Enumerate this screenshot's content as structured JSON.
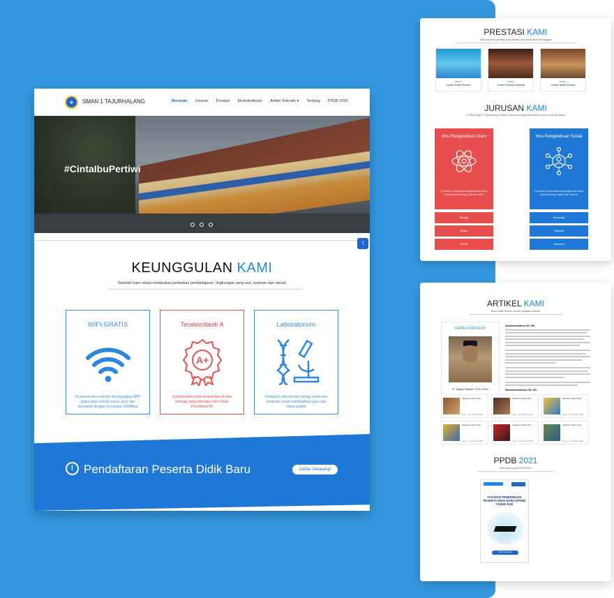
{
  "site": {
    "school_name": "SMAN 1 TAJURHALANG",
    "nav": [
      "Beranda",
      "Jurusan",
      "Prestasi",
      "Ekstrakulikuler",
      "Artikel Sekolah ▾",
      "Tentang",
      "PPDB 2020"
    ],
    "active_nav": "Beranda"
  },
  "hero": {
    "hashtag": "#CintaIbuPertiwi",
    "slides": 3
  },
  "keunggulan": {
    "title_a": "KEUNGGULAN ",
    "title_b": "KAMI",
    "subtitle": "Sekolah kami selalu melakukan perbaikan pembelajaran, lingkungan yang asri, nyaman dan ramah",
    "features": [
      {
        "title": "WIFI GRATIS",
        "icon": "wifi-icon",
        "desc": "Di semua area sekolah ini terjangkau WIFI gratis bagi seluruh siswa, guru dan karyawan dengan kecepatan 100Mbps"
      },
      {
        "title": "Terakrediasti A",
        "icon": "award-icon",
        "desc": "Sekolah kami telah terakreditasi A nilai tertinggi yang diberikan oleh Dinas Pendidikan RI"
      },
      {
        "title": "Laboratorium",
        "icon": "lab-icon",
        "desc": "Terdapat Laboratorium biologi, kimia dan komputer untuk memfasilitasi guru dan siswa praktik"
      }
    ]
  },
  "ppdb_banner": {
    "text": "Pendaftaran Peserta Didik Baru",
    "button": "Daftar Sekarang!"
  },
  "prestasi": {
    "title_a": "PRESTASI ",
    "title_b": "KAMI",
    "subtitle": "Kilas sejumlah prestasi yang didapat oleh siswa-siswi kebanggaan",
    "items": [
      {
        "rank": "Juara 1",
        "event": "Lomba Teater Provinsi"
      },
      {
        "rank": "Juara 1",
        "event": "Lomba Drumline Nasional"
      },
      {
        "rank": "Juara 1",
        "event": "Lomba Teater Provinsi"
      }
    ]
  },
  "jurusan": {
    "title_a": "JURUSAN ",
    "title_b": "KAMI",
    "subtitle": "Di SMA negeri 1 Tajurhalang, terdapat dua jurusan yang bisa dipilih sesuai minat dan bakat",
    "ipa": {
      "title": "Ilmu Pengetahuan Alam",
      "desc": "Di jurusan ini kamu akan mempelajari ilmu-ilmu eksakta seperti biologi, fisika dan kimia",
      "subjects": [
        "Biologi",
        "Fisika",
        "Kimia"
      ]
    },
    "ips": {
      "title": "Ilmu Pengetahuan Sosial",
      "desc": "Di jurusan ini kamu akan mempelajari ilmu sosial seperti sosiologi, sejarah dan ekonomi",
      "subjects": [
        "Sosiologi",
        "Sejarah",
        "Ekonomi"
      ]
    }
  },
  "artikel": {
    "title_a": "ARTIKEL ",
    "title_b": "KAMI",
    "subtitle": "Baca artikel terbaru seputar kegiatan sekolah",
    "kepala_label": "KEPALA SEKOLAH",
    "kepala_name": "H. Jajang Hidayat, S.Pd. M.Pd",
    "greeting": "Assalamualaikum Wr. Wb.",
    "closing": "Wassalamualaikum Wr. Wb.",
    "posts": [
      {
        "title": "Sebelum kalian tahu",
        "meta": "Kamis, 12 Oktober 2020"
      },
      {
        "title": "Sebelum kalian tahu",
        "meta": "Kamis, 12 Oktober 2020"
      },
      {
        "title": "Sebelum kalian tahu",
        "meta": "Kamis, 12 Oktober 2020"
      },
      {
        "title": "Sebelum kalian tahu",
        "meta": "Kamis, 12 Oktober 2020"
      },
      {
        "title": "Sebelum kalian tahu",
        "meta": "Kamis, 12 Oktober 2020"
      },
      {
        "title": "Sebelum kalian tahu",
        "meta": "Kamis, 12 Oktober 2020"
      }
    ]
  },
  "ppdb": {
    "title_a": "PPDB ",
    "title_b": "2021",
    "subtitle": "Informasi seputar PPDB 2021",
    "poster_title": "TAHAPAN PENERIMAAN PESERTA DIDIK BARU (PPDB) TAHUN 2020",
    "poster_button": "Daftar Sekarang"
  },
  "colors": {
    "background": "#3498e0",
    "primary": "#1e88e5",
    "red": "#e74c4c",
    "band": "#1f78d6"
  }
}
